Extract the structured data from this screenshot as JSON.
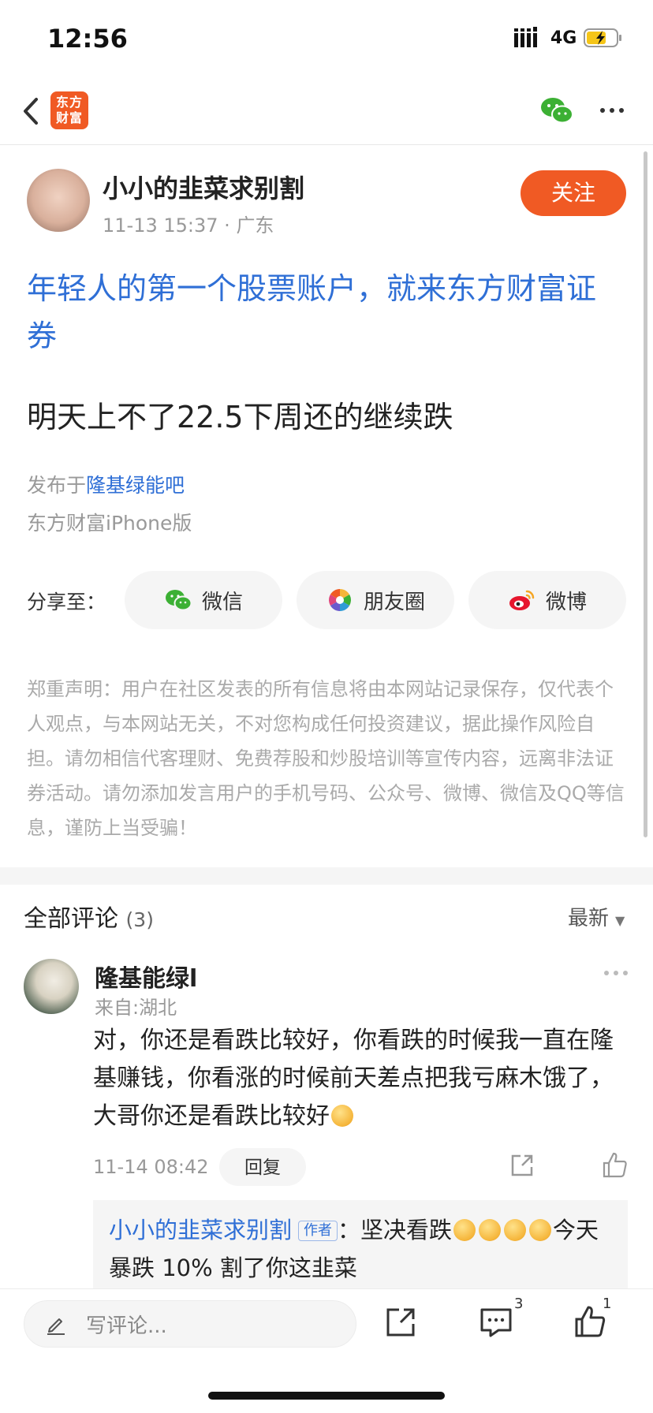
{
  "status_bar": {
    "time": "12:56",
    "network": "4G"
  },
  "nav": {
    "logo_line1": "东方",
    "logo_line2": "财富"
  },
  "post": {
    "author": "小小的韭菜求别割",
    "date": "11-13 15:37",
    "location": "广东",
    "follow_label": "关注",
    "ad_title": "年轻人的第一个股票账户，就来东方财富证券",
    "body": "明天上不了22.5下周还的继续跌",
    "published_prefix": "发布于",
    "forum": "隆基绿能吧",
    "client": "东方财富iPhone版"
  },
  "share": {
    "label": "分享至：",
    "options": [
      {
        "label": "微信",
        "icon": "wechat-icon"
      },
      {
        "label": "朋友圈",
        "icon": "moments-icon"
      },
      {
        "label": "微博",
        "icon": "weibo-icon"
      }
    ]
  },
  "disclaimer": "郑重声明：用户在社区发表的所有信息将由本网站记录保存，仅代表个人观点，与本网站无关，不对您构成任何投资建议，据此操作风险自担。请勿相信代客理财、免费荐股和炒股培训等宣传内容，远离非法证券活动。请勿添加发言用户的手机号码、公众号、微博、微信及QQ等信息，谨防上当受骗！",
  "comments": {
    "title": "全部评论",
    "count": "(3)",
    "sort_label": "最新",
    "items": [
      {
        "name": "隆基能绿l",
        "location": "来自:湖北",
        "text": "对，你还是看跌比较好，你看跌的时候我一直在隆基赚钱，你看涨的时候前天差点把我亏麻木饿了，大哥你还是看跌比较好",
        "date": "11-14 08:42",
        "reply_label": "回复",
        "reply": {
          "author": "小小的韭菜求别割",
          "tag": "作者",
          "prefix": "：坚决看跌",
          "suffix": "今天暴跌 10% 割了你这韭菜"
        }
      }
    ]
  },
  "bottom_bar": {
    "input_placeholder": "写评论...",
    "comment_count": "3",
    "like_count": "1"
  },
  "colors": {
    "brand": "#f05a24",
    "link": "#2f6fd6",
    "wechat_green": "#3cb034"
  }
}
